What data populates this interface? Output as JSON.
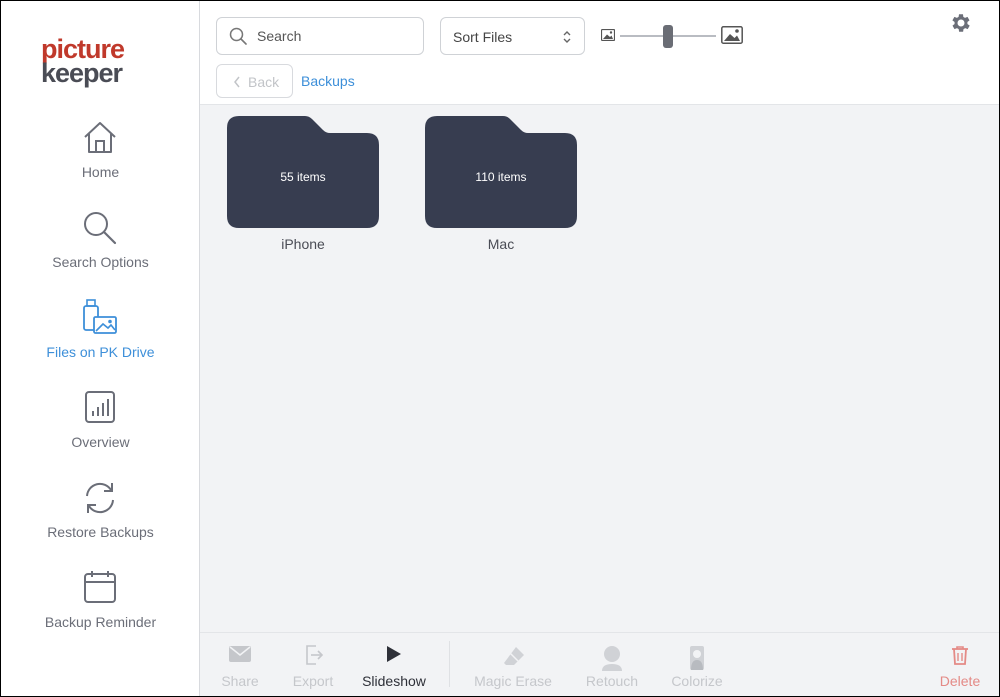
{
  "app": {
    "logo_line1": "picture",
    "logo_line2": "keeper",
    "colors": {
      "accent": "#3d8fd9",
      "folder": "#373d50",
      "logo_red": "#c0392b",
      "danger": "#e48a86"
    }
  },
  "sidebar": {
    "items": [
      {
        "label": "Home",
        "icon": "home-icon",
        "active": false
      },
      {
        "label": "Search Options",
        "icon": "magnifier-icon",
        "active": false
      },
      {
        "label": "Files on PK Drive",
        "icon": "usb-drive-icon",
        "active": true
      },
      {
        "label": "Overview",
        "icon": "bar-chart-icon",
        "active": false
      },
      {
        "label": "Restore Backups",
        "icon": "refresh-icon",
        "active": false
      },
      {
        "label": "Backup Reminder",
        "icon": "calendar-icon",
        "active": false
      }
    ]
  },
  "header": {
    "search_placeholder": "Search",
    "sort_label": "Sort Files",
    "zoom_level": 0.5,
    "back_label": "Back",
    "breadcrumb": "Backups"
  },
  "folders": [
    {
      "name": "iPhone",
      "count": "55 items"
    },
    {
      "name": "Mac",
      "count": "110 items"
    }
  ],
  "toolbar": {
    "share": "Share",
    "export": "Export",
    "slideshow": "Slideshow",
    "magic_erase": "Magic Erase",
    "retouch": "Retouch",
    "colorize": "Colorize",
    "delete": "Delete"
  }
}
